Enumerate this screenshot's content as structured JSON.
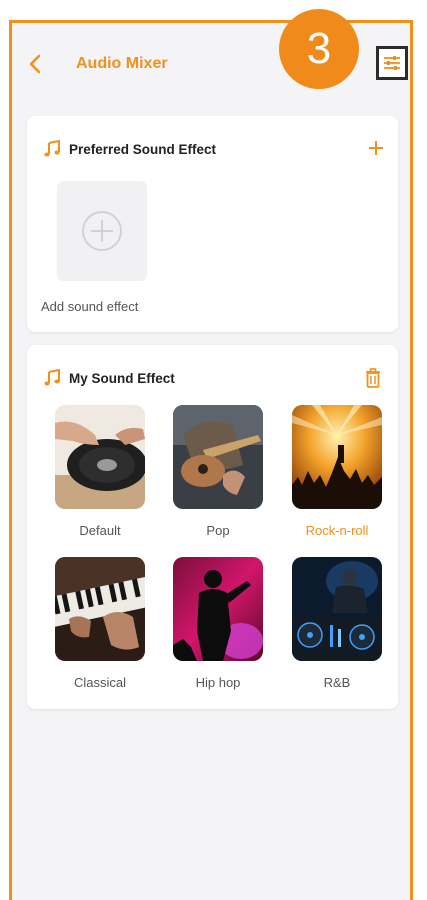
{
  "header": {
    "title": "Audio Mixer",
    "step_number": "3"
  },
  "preferred": {
    "heading": "Preferred Sound Effect",
    "add_tile_label": "Add sound effect"
  },
  "my_effects": {
    "heading": "My Sound Effect",
    "selected": "Rock-n-roll",
    "items": [
      {
        "name": "Default"
      },
      {
        "name": "Pop"
      },
      {
        "name": "Rock-n-roll"
      },
      {
        "name": "Classical"
      },
      {
        "name": "Hip hop"
      },
      {
        "name": "R&B"
      }
    ]
  },
  "colors": {
    "accent": "#f2901c",
    "background": "#f4f4f6"
  }
}
